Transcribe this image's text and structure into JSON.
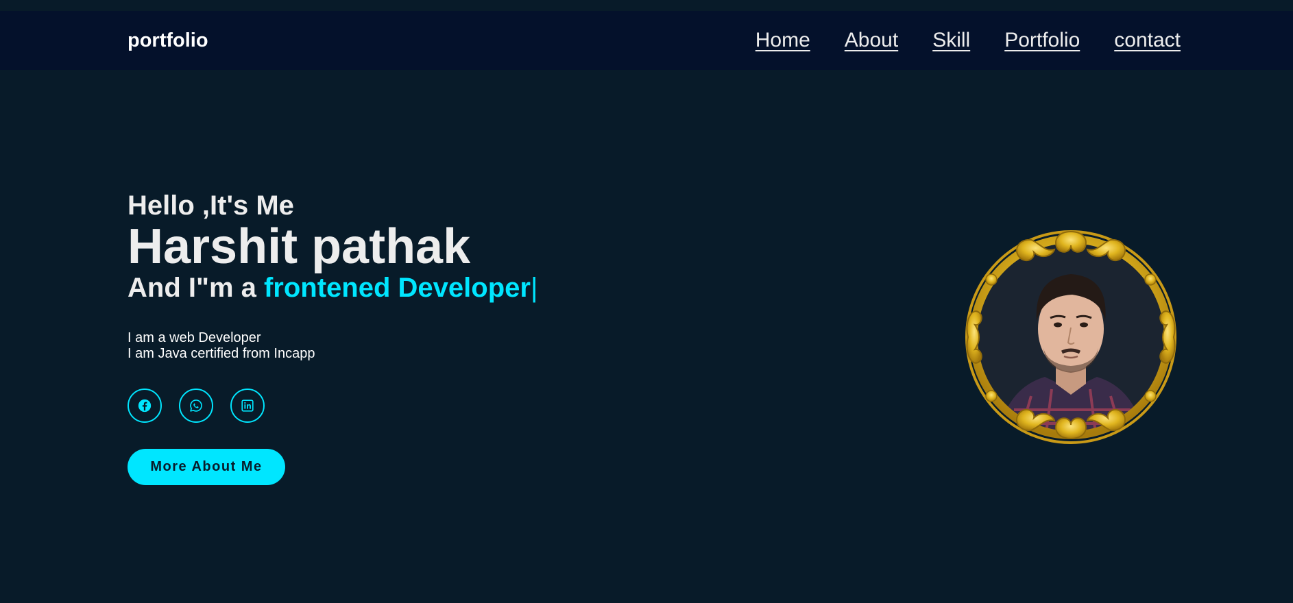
{
  "header": {
    "logo": "portfolio",
    "nav": [
      {
        "label": "Home"
      },
      {
        "label": "About"
      },
      {
        "label": "Skill"
      },
      {
        "label": "Portfolio"
      },
      {
        "label": "contact"
      }
    ]
  },
  "hero": {
    "greeting": "Hello ,It's Me",
    "name": "Harshit pathak",
    "role_prefix": "And I\"m a ",
    "role_highlight": "frontened Developer",
    "role_cursor": "|",
    "bio": [
      "I am a web Developer",
      "I am Java certified from Incapp"
    ],
    "socials": [
      {
        "icon": "facebook-icon"
      },
      {
        "icon": "whatsapp-icon"
      },
      {
        "icon": "linkedin-icon"
      }
    ],
    "cta_label": "More About Me"
  },
  "colors": {
    "background": "#081b29",
    "header": "#04112b",
    "accent": "#00e6ff",
    "frame_gold": "#e0b51f"
  }
}
